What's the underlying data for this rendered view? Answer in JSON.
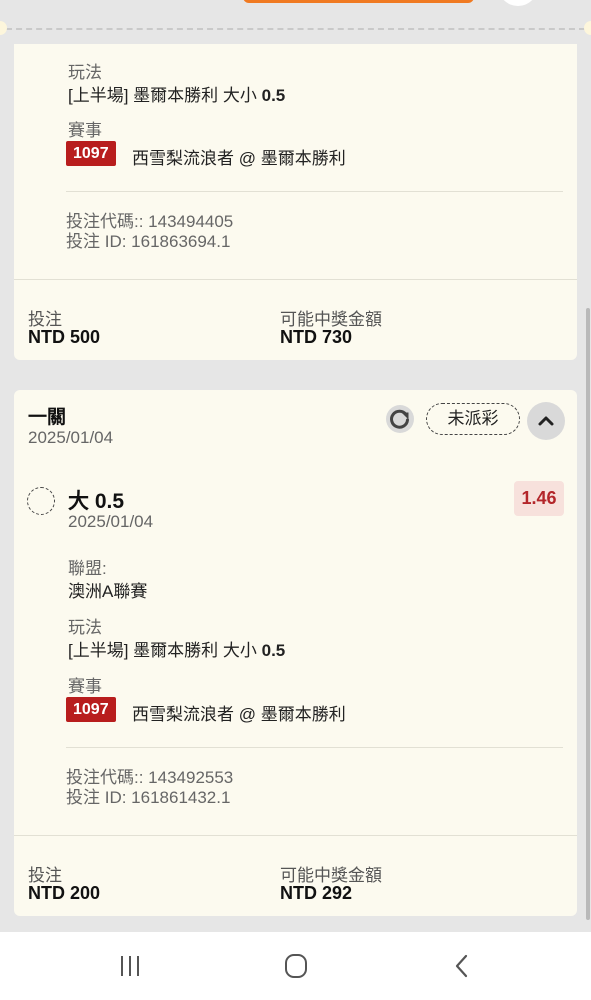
{
  "colors": {
    "accent": "#f07a22",
    "badge": "#b81d1d",
    "odds_bg": "#f7e1dc",
    "odds_text": "#b3262a",
    "card_bg": "#fcfaef"
  },
  "bet1": {
    "play_label": "玩法",
    "play_prefix": "[上半場] 墨爾本勝利 大小 ",
    "play_line": "0.5",
    "event_label": "賽事",
    "event_id": "1097",
    "event_match": "西雪梨流浪者 @ 墨爾本勝利",
    "bet_code": "投注代碼:: 143494405",
    "bet_id": "投注 ID: 161863694.1",
    "stake_label": "投注",
    "stake_value": "NTD 500",
    "payout_label": "可能中獎金額",
    "payout_value": "NTD 730"
  },
  "bet2": {
    "type": "一關",
    "date": "2025/01/04",
    "status": "未派彩",
    "icons": {
      "refresh": "refresh-icon",
      "collapse": "chevron-up-icon",
      "radio": "radio-icon"
    },
    "selection": "大 0.5",
    "selection_date": "2025/01/04",
    "odds": "1.46",
    "league_label": "聯盟:",
    "league_value": "澳洲A聯賽",
    "play_label": "玩法",
    "play_prefix": "[上半場] 墨爾本勝利 大小 ",
    "play_line": "0.5",
    "event_label": "賽事",
    "event_id": "1097",
    "event_match": "西雪梨流浪者 @ 墨爾本勝利",
    "bet_code": "投注代碼:: 143492553",
    "bet_id": "投注 ID: 161861432.1",
    "stake_label": "投注",
    "stake_value": "NTD 200",
    "payout_label": "可能中獎金額",
    "payout_value": "NTD 292"
  },
  "navbar": {
    "icons": [
      "recent-apps-icon",
      "home-icon",
      "back-icon"
    ]
  }
}
